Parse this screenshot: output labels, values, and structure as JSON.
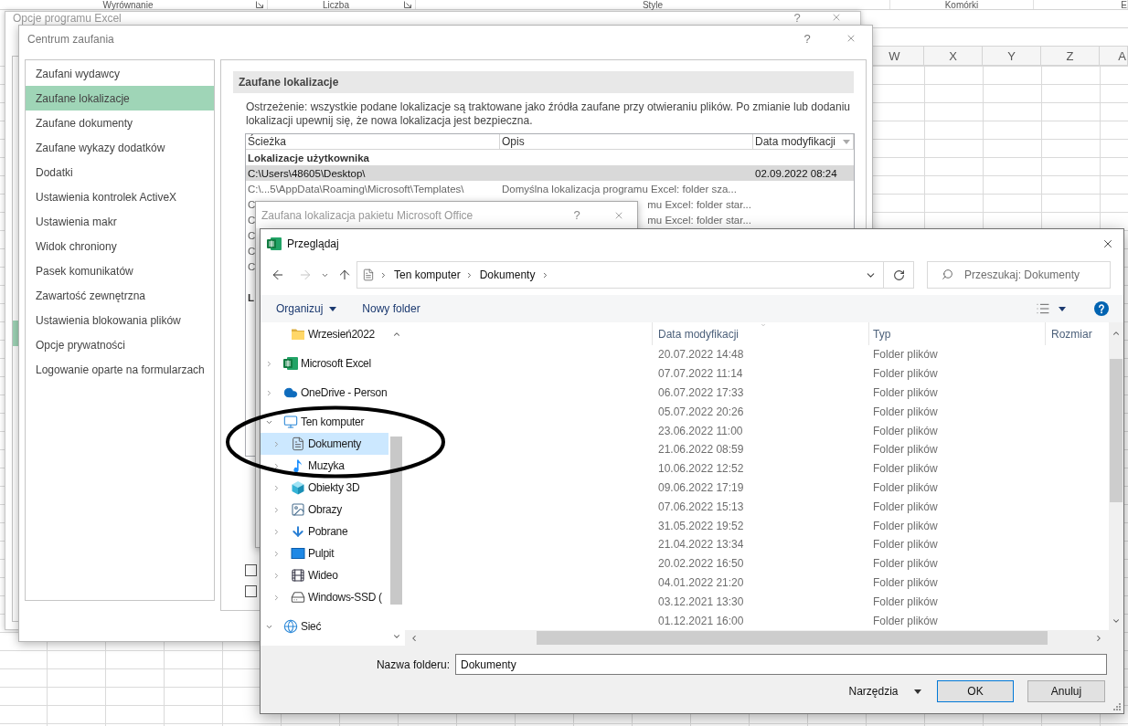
{
  "excel": {
    "ribbon_groups": [
      {
        "label": "Wyrównanie",
        "launcher": true
      },
      {
        "label": "Liczba",
        "launcher": true
      },
      {
        "label": "Style",
        "launcher": false
      },
      {
        "label": "Komórki",
        "launcher": false
      },
      {
        "label": "E",
        "launcher": false
      }
    ],
    "columns": [
      "W",
      "X",
      "Y",
      "Z",
      "A"
    ]
  },
  "options_window": {
    "title": "Opcje programu Excel",
    "help": "?"
  },
  "trust_center": {
    "title": "Centrum zaufania",
    "help": "?",
    "categories": [
      {
        "label": "Zaufani wydawcy",
        "selected": false
      },
      {
        "label": "Zaufane lokalizacje",
        "selected": true
      },
      {
        "label": "Zaufane dokumenty",
        "selected": false
      },
      {
        "label": "Zaufane wykazy dodatków",
        "selected": false
      },
      {
        "label": "Dodatki",
        "selected": false
      },
      {
        "label": "Ustawienia kontrolek ActiveX",
        "selected": false
      },
      {
        "label": "Ustawienia makr",
        "selected": false
      },
      {
        "label": "Widok chroniony",
        "selected": false
      },
      {
        "label": "Pasek komunikatów",
        "selected": false
      },
      {
        "label": "Zawartość zewnętrzna",
        "selected": false
      },
      {
        "label": "Ustawienia blokowania plików",
        "selected": false
      },
      {
        "label": "Opcje prywatności",
        "selected": false
      },
      {
        "label": "Logowanie oparte na formularzach",
        "selected": false
      }
    ],
    "section_title": "Zaufane lokalizacje",
    "warning": "Ostrzeżenie: wszystkie podane lokalizacje są traktowane jako źródła zaufane przy otwieraniu plików. Po zmianie lub dodaniu lokalizacji upewnij się, że nowa lokalizacja jest bezpieczna.",
    "table": {
      "columns": [
        {
          "label": "Ścieżka",
          "sorted": false
        },
        {
          "label": "Opis",
          "sorted": false
        },
        {
          "label": "Data modyfikacji",
          "sorted": true
        }
      ],
      "rows": [
        {
          "kind": "group",
          "label": "Lokalizacje użytkownika"
        },
        {
          "kind": "entry",
          "selected": true,
          "path": "C:\\Users\\48605\\Desktop\\",
          "date": "02.09.2022 08:24"
        },
        {
          "kind": "entry",
          "selected": false,
          "path": "C:\\...5\\AppData\\Roaming\\Microsoft\\Templates\\",
          "description": "Domyślna lokalizacja programu Excel: folder sza..."
        },
        {
          "kind": "covered",
          "selected": false,
          "path_head": "C",
          "description_tail": "mu Excel: folder star..."
        },
        {
          "kind": "covered",
          "selected": false,
          "path_head": "C",
          "description_tail": "mu Excel: folder star..."
        },
        {
          "kind": "covered",
          "selected": false,
          "path_head": "C"
        },
        {
          "kind": "covered",
          "selected": false,
          "path_head": "C"
        },
        {
          "kind": "covered",
          "selected": false,
          "path_head": "C"
        },
        {
          "kind": "group",
          "label": "L"
        }
      ]
    },
    "checkboxes": [
      {
        "checked": false
      },
      {
        "checked": false
      }
    ]
  },
  "location_dialog": {
    "title": "Zaufana lokalizacja pakietu Microsoft Office",
    "help": "?"
  },
  "browse_dialog": {
    "title": "Przeglądaj",
    "address": [
      "Ten komputer",
      "Dokumenty"
    ],
    "search": {
      "placeholder": "Przeszukaj: Dokumenty"
    },
    "toolbar": {
      "organize": "Organizuj",
      "new_folder": "Nowy folder"
    },
    "nav_tree": {
      "scrolled_children": [
        {
          "label": "Wrzesień2022",
          "kind": "folder",
          "selected": false
        }
      ],
      "items": [
        {
          "label": "Microsoft Excel",
          "kind": "excel",
          "expanded": false,
          "selected": false
        },
        {
          "label": "OneDrive - Person",
          "kind": "cloud",
          "expanded": false,
          "selected": false
        },
        {
          "label": "Ten komputer",
          "kind": "computer",
          "expanded": true,
          "selected": false,
          "children": [
            {
              "label": "Dokumenty",
              "kind": "documents",
              "expanded": false,
              "selected": true
            },
            {
              "label": "Muzyka",
              "kind": "music",
              "expanded": false,
              "selected": false
            },
            {
              "label": "Obiekty 3D",
              "kind": "objects",
              "expanded": false,
              "selected": false
            },
            {
              "label": "Obrazy",
              "kind": "pictures",
              "expanded": false,
              "selected": false
            },
            {
              "label": "Pobrane",
              "kind": "downloads",
              "expanded": false,
              "selected": false
            },
            {
              "label": "Pulpit",
              "kind": "desktop",
              "expanded": false,
              "selected": false
            },
            {
              "label": "Wideo",
              "kind": "videos",
              "expanded": false,
              "selected": false
            },
            {
              "label": "Windows-SSD (",
              "kind": "drive",
              "expanded": false,
              "selected": false
            }
          ]
        },
        {
          "label": "Sieć",
          "kind": "network",
          "expanded": true,
          "selected": false
        }
      ]
    },
    "columns": [
      {
        "label": "Data modyfikacji",
        "sorted": true
      },
      {
        "label": "Typ",
        "sorted": false
      },
      {
        "label": "Rozmiar",
        "sorted": false
      }
    ],
    "files": [
      {
        "modified": "20.07.2022 14:48",
        "type": "Folder plików",
        "selected": false
      },
      {
        "modified": "07.07.2022 11:14",
        "type": "Folder plików",
        "selected": false
      },
      {
        "modified": "06.07.2022 17:33",
        "type": "Folder plików",
        "selected": false
      },
      {
        "modified": "05.07.2022 20:26",
        "type": "Folder plików",
        "selected": false
      },
      {
        "modified": "23.06.2022 11:00",
        "type": "Folder plików",
        "selected": false
      },
      {
        "modified": "21.06.2022 08:59",
        "type": "Folder plików",
        "selected": false
      },
      {
        "modified": "10.06.2022 12:52",
        "type": "Folder plików",
        "selected": false
      },
      {
        "modified": "09.06.2022 17:19",
        "type": "Folder plików",
        "selected": false
      },
      {
        "modified": "07.06.2022 15:13",
        "type": "Folder plików",
        "selected": false
      },
      {
        "modified": "31.05.2022 19:52",
        "type": "Folder plików",
        "selected": false
      },
      {
        "modified": "21.04.2022 13:34",
        "type": "Folder plików",
        "selected": false
      },
      {
        "modified": "20.02.2022 16:50",
        "type": "Folder plików",
        "selected": false
      },
      {
        "modified": "04.01.2022 21:20",
        "type": "Folder plików",
        "selected": false
      },
      {
        "modified": "03.12.2021 13:30",
        "type": "Folder plików",
        "selected": false
      },
      {
        "modified": "01.12.2021 16:00",
        "type": "Folder plików",
        "selected": false
      }
    ],
    "folder_name": {
      "label": "Nazwa folderu:",
      "value": "Dokumenty"
    },
    "buttons": [
      {
        "label": "Narzędzia",
        "kind": "menu"
      },
      {
        "label": "OK",
        "kind": "ok"
      },
      {
        "label": "Anuluj",
        "kind": "cancel"
      }
    ]
  }
}
